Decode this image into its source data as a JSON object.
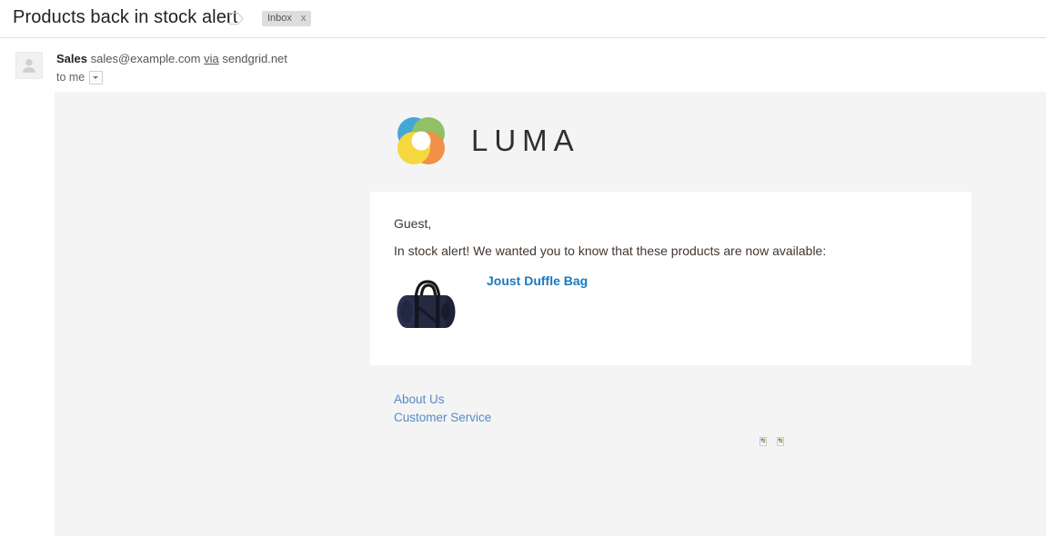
{
  "header": {
    "subject": "Products back in stock alert",
    "label_tag_icon": "label-tag-icon",
    "inbox_chip": {
      "label": "Inbox",
      "close": "x"
    }
  },
  "sender": {
    "avatar_icon": "person-placeholder-icon",
    "name": "Sales",
    "email": "sales@example.com",
    "via": "via",
    "via_domain": "sendgrid.net",
    "recipient": "to me",
    "details_caret_icon": "chevron-down-icon"
  },
  "email": {
    "brand": {
      "logo_mark_icon": "luma-circles-logo-icon",
      "wordmark": "LUMA",
      "colors": {
        "blue": "#2196d3",
        "green": "#7ab648",
        "orange": "#f07c22",
        "yellow": "#f5d315",
        "wordmark": "#2f2f2f"
      }
    },
    "card": {
      "greeting": "Guest,",
      "intro": "In stock alert! We wanted you to know that these products are now available:",
      "products": [
        {
          "image_icon": "joust-duffle-bag-image",
          "name": "Joust Duffle Bag",
          "link_color": "#1979c3"
        }
      ]
    },
    "footer": {
      "links": [
        {
          "label": "About Us"
        },
        {
          "label": "Customer Service"
        }
      ],
      "link_color": "#5689c8",
      "broken_images": [
        {
          "icon": "broken-image-icon"
        },
        {
          "icon": "broken-image-icon"
        }
      ]
    },
    "background_color": "#f4f4f4"
  }
}
